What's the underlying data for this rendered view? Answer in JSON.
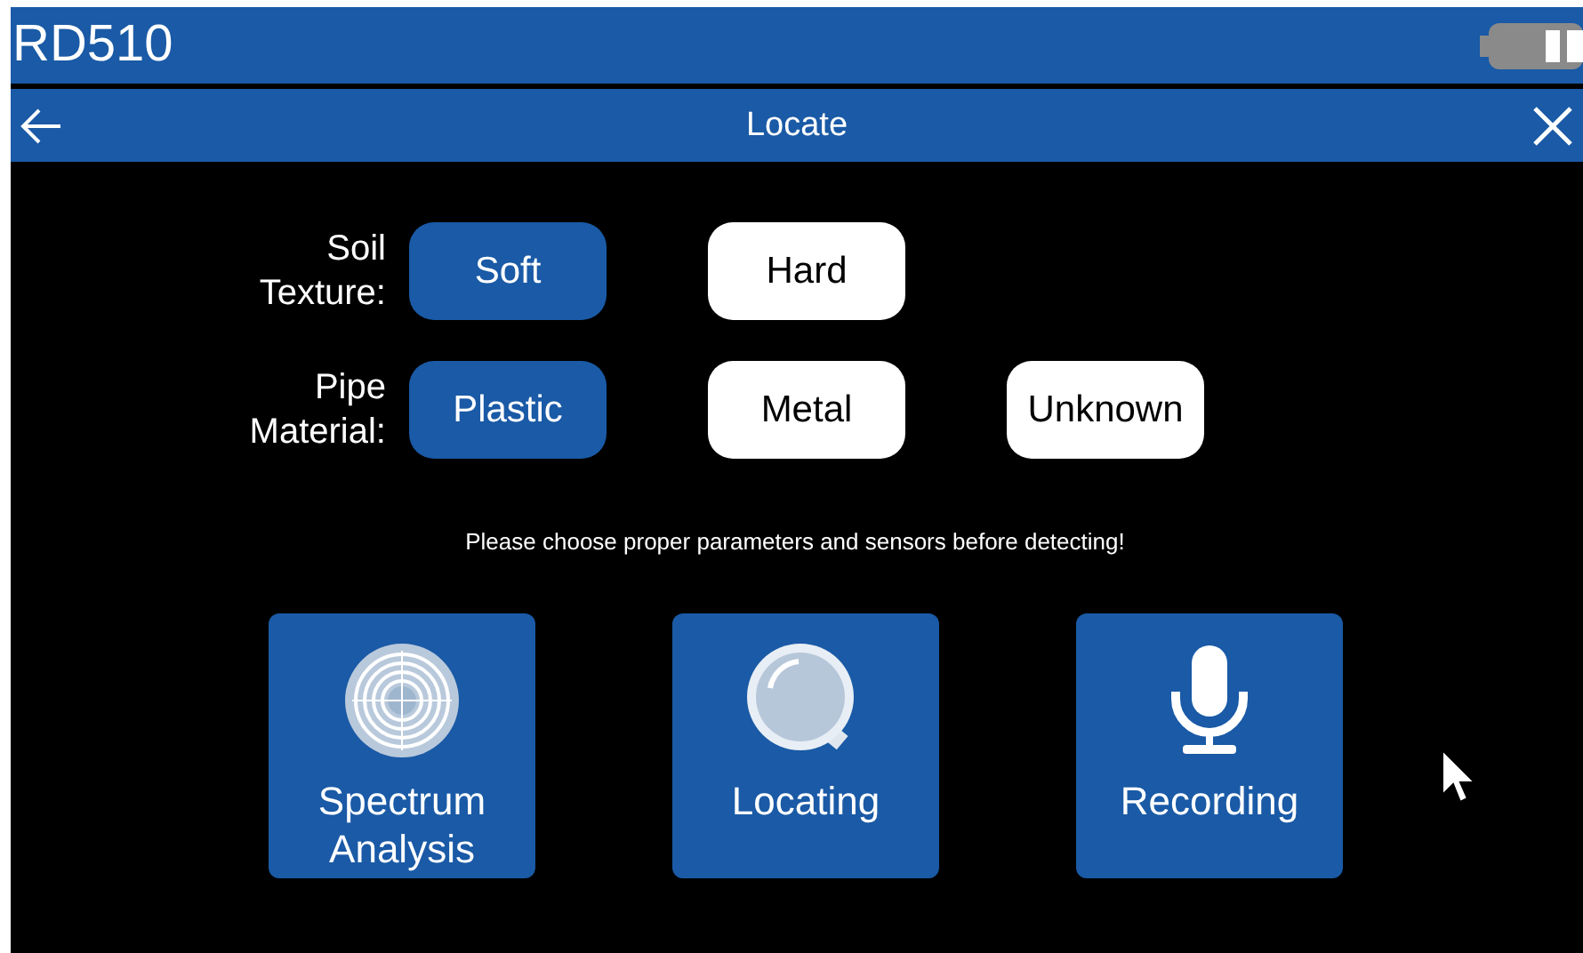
{
  "header": {
    "title": "RD510"
  },
  "nav": {
    "title": "Locate"
  },
  "parameters": [
    {
      "label": "Soil\nTexture:",
      "options": [
        {
          "label": "Soft",
          "selected": true
        },
        {
          "label": "Hard",
          "selected": false
        }
      ]
    },
    {
      "label": "Pipe\nMaterial:",
      "options": [
        {
          "label": "Plastic",
          "selected": true
        },
        {
          "label": "Metal",
          "selected": false
        },
        {
          "label": "Unknown",
          "selected": false
        }
      ]
    }
  ],
  "message": "Please choose proper parameters and sensors before detecting!",
  "modes": [
    {
      "kind": "spectrum",
      "label": "Spectrum\nAnalysis"
    },
    {
      "kind": "locate",
      "label": "Locating"
    },
    {
      "kind": "record",
      "label": "Recording"
    }
  ]
}
